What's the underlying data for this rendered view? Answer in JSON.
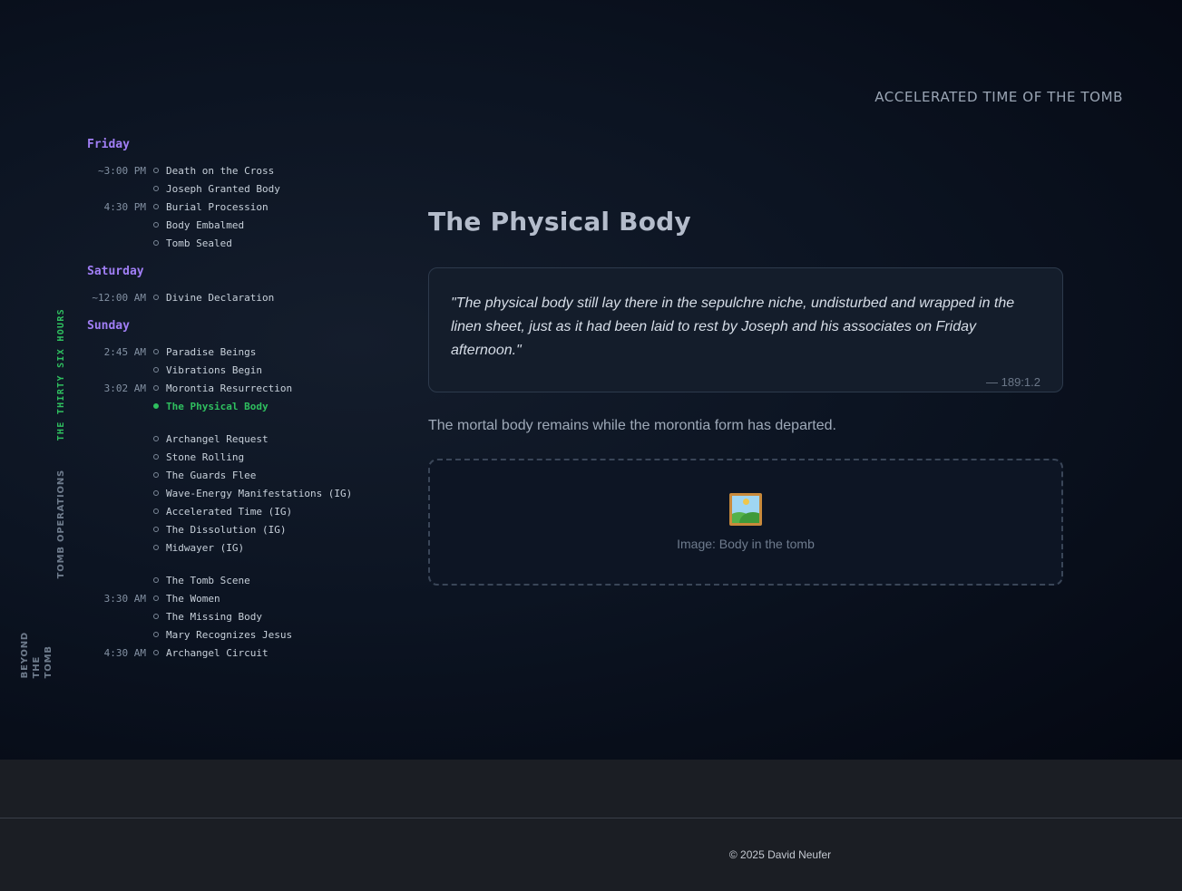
{
  "header": {
    "title": "ACCELERATED TIME OF THE TOMB"
  },
  "side_tabs": {
    "active": "THE THIRTY SIX HOURS",
    "ops": "TOMB OPERATIONS",
    "beyond": [
      "BEYOND",
      "THE",
      "TOMB"
    ]
  },
  "timeline": {
    "days": [
      {
        "name": "Friday",
        "events": [
          {
            "time": "~3:00 PM",
            "label": "Death on the Cross"
          },
          {
            "time": "",
            "label": "Joseph Granted Body"
          },
          {
            "time": "4:30 PM",
            "label": "Burial Procession"
          },
          {
            "time": "",
            "label": "Body Embalmed"
          },
          {
            "time": "",
            "label": "Tomb Sealed"
          }
        ]
      },
      {
        "name": "Saturday",
        "events": [
          {
            "time": "~12:00 AM",
            "label": "Divine Declaration"
          }
        ]
      },
      {
        "name": "Sunday",
        "groups": [
          [
            {
              "time": "2:45 AM",
              "label": "Paradise Beings"
            },
            {
              "time": "",
              "label": "Vibrations Begin"
            },
            {
              "time": "3:02 AM",
              "label": "Morontia Resurrection"
            },
            {
              "time": "",
              "label": "The Physical Body"
            }
          ],
          [
            {
              "time": "",
              "label": "Archangel Request"
            },
            {
              "time": "",
              "label": "Stone Rolling"
            },
            {
              "time": "",
              "label": "The Guards Flee"
            },
            {
              "time": "",
              "label": "Wave-Energy Manifestations (IG)"
            },
            {
              "time": "",
              "label": "Accelerated Time (IG)"
            },
            {
              "time": "",
              "label": "The Dissolution (IG)"
            },
            {
              "time": "",
              "label": "Midwayer (IG)"
            }
          ],
          [
            {
              "time": "",
              "label": "The Tomb Scene"
            },
            {
              "time": "3:30 AM",
              "label": "The Women"
            },
            {
              "time": "",
              "label": "The Missing Body"
            },
            {
              "time": "",
              "label": "Mary Recognizes Jesus"
            },
            {
              "time": "4:30 AM",
              "label": "Archangel Circuit"
            }
          ]
        ]
      }
    ],
    "active_label": "The Physical Body"
  },
  "main": {
    "title": "The Physical Body",
    "quote": "\"The physical body still lay there in the sepulchre niche, undisturbed and wrapped in the linen sheet, just as it had been laid to rest by Joseph and his associates on Friday afternoon.\"",
    "quote_ref": "— 189:1.2",
    "description": "The mortal body remains while the morontia form has departed.",
    "image_icon": "framed-picture-icon",
    "image_caption": "Image: Body in the tomb"
  },
  "footer": {
    "copyright": "© 2025 David Neufer"
  },
  "colors": {
    "accent_green": "#2fbf5f",
    "day_purple": "#a07ef5",
    "background": "#0c1422",
    "footer_bg": "#1b1e24"
  }
}
